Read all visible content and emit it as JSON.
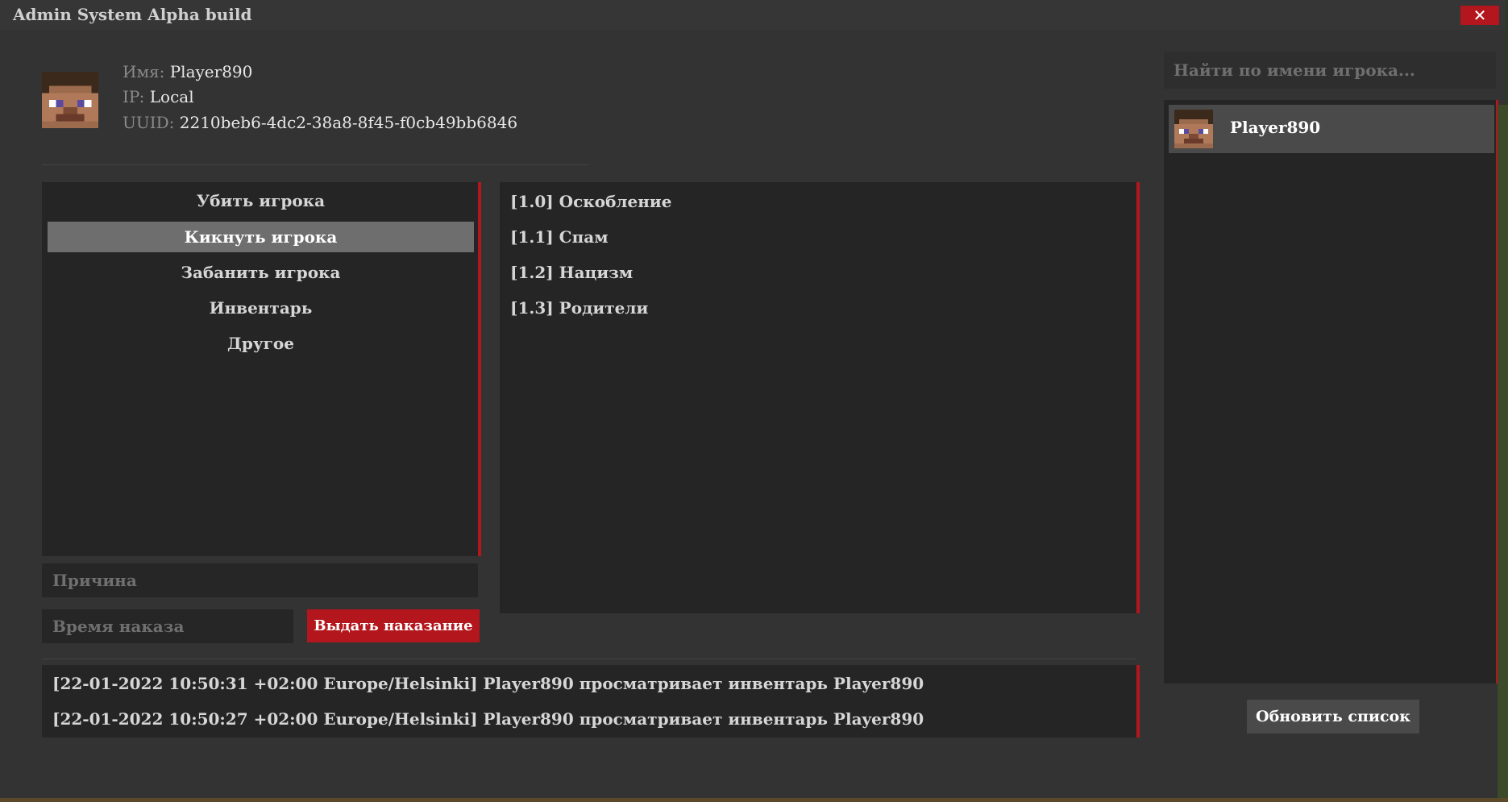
{
  "window": {
    "title": "Admin System Alpha build",
    "close_glyph": "✕"
  },
  "player_info": {
    "name_label": "Имя:",
    "name_value": "Player890",
    "ip_label": "IP:",
    "ip_value": "Local",
    "uuid_label": "UUID:",
    "uuid_value": "2210beb6-4dc2-38a8-8f45-f0cb49bb6846",
    "avatar_icon": "player-head-icon"
  },
  "actions": {
    "items": [
      {
        "label": "Убить игрока",
        "selected": false
      },
      {
        "label": "Кикнуть игрока",
        "selected": true
      },
      {
        "label": "Забанить игрока",
        "selected": false
      },
      {
        "label": "Инвентарь",
        "selected": false
      },
      {
        "label": "Другое",
        "selected": false
      }
    ]
  },
  "reasons": {
    "items": [
      {
        "label": "[1.0] Оскобление"
      },
      {
        "label": "[1.1] Спам"
      },
      {
        "label": "[1.2] Нацизм"
      },
      {
        "label": "[1.3] Родители"
      }
    ]
  },
  "form": {
    "reason_placeholder": "Причина",
    "time_placeholder": "Время наказа",
    "punish_button": "Выдать наказание"
  },
  "log": {
    "lines": [
      "[22-01-2022 10:50:31 +02:00 Europe/Helsinki] Player890 просматривает инвентарь  Player890",
      "[22-01-2022 10:50:27 +02:00 Europe/Helsinki] Player890 просматривает инвентарь  Player890"
    ]
  },
  "sidebar": {
    "search_placeholder": "Найти по имени игрока...",
    "players": [
      {
        "name": "Player890",
        "avatar_icon": "player-head-icon"
      }
    ],
    "refresh_button": "Обновить список"
  },
  "colors": {
    "accent": "#b3161c",
    "panel": "#252525",
    "selected": "#6e6e6e"
  }
}
